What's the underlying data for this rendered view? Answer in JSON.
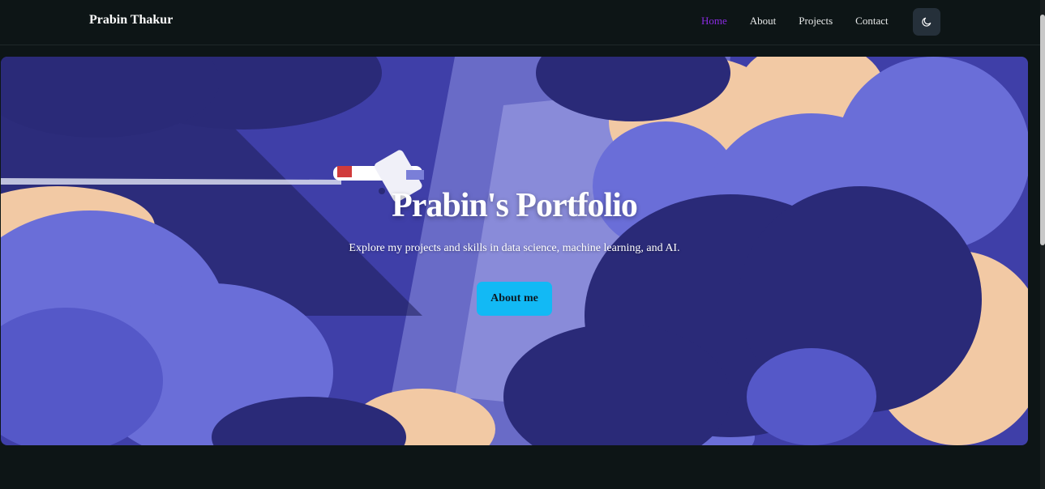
{
  "navbar": {
    "brand": "Prabin Thakur",
    "links": [
      {
        "label": "Home",
        "active": true
      },
      {
        "label": "About",
        "active": false
      },
      {
        "label": "Projects",
        "active": false
      },
      {
        "label": "Contact",
        "active": false
      }
    ],
    "theme_toggle_icon": "moon-icon"
  },
  "hero": {
    "title": "Prabin's Portfolio",
    "subtitle": "Explore my projects and skills in data science, machine learning, and AI.",
    "button_label": "About me"
  },
  "colors": {
    "background": "#0d1516",
    "active_link": "#8a2be2",
    "button": "#12b9f5",
    "sky": "#3f3fa8",
    "cloud_light": "#6a6ed8",
    "cloud_dark": "#2a2a78",
    "cloud_peach": "#f2c9a4"
  }
}
